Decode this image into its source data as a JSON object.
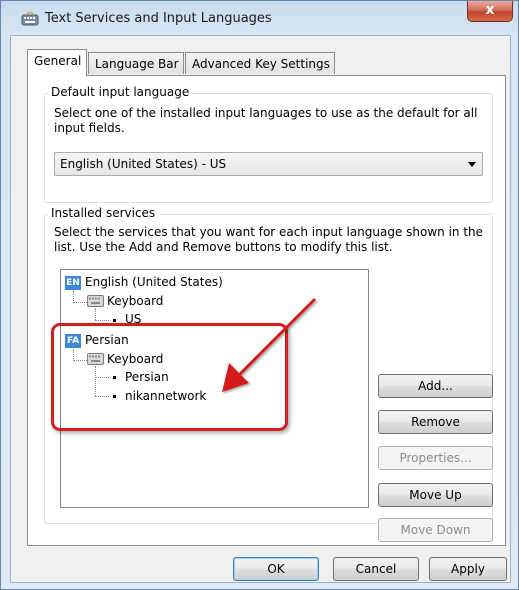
{
  "window": {
    "title": "Text Services and Input Languages",
    "close_label": "x"
  },
  "tabs": [
    {
      "label": "General",
      "active": true
    },
    {
      "label": "Language Bar",
      "active": false
    },
    {
      "label": "Advanced Key Settings",
      "active": false
    }
  ],
  "default_input": {
    "group_label": "Default input language",
    "description": "Select one of the installed input languages to use as the default for all input fields.",
    "selected": "English (United States) - US"
  },
  "installed_services": {
    "group_label": "Installed services",
    "description": "Select the services that you want for each input language shown in the list. Use the Add and Remove buttons to modify this list.",
    "tree": {
      "lang1": {
        "badge": "EN",
        "name": "English (United States)",
        "keyboard_label": "Keyboard",
        "layouts": [
          "US"
        ]
      },
      "lang2": {
        "badge": "FA",
        "name": "Persian",
        "keyboard_label": "Keyboard",
        "layouts": [
          "Persian",
          "nikannetwork"
        ]
      }
    },
    "buttons": {
      "add": "Add...",
      "remove": "Remove",
      "properties": "Properties...",
      "move_up": "Move Up",
      "move_down": "Move Down"
    }
  },
  "footer": {
    "ok": "OK",
    "cancel": "Cancel",
    "apply": "Apply"
  },
  "colors": {
    "annotation_red": "#d21e1e",
    "badge_blue": "#3c8ad6"
  }
}
